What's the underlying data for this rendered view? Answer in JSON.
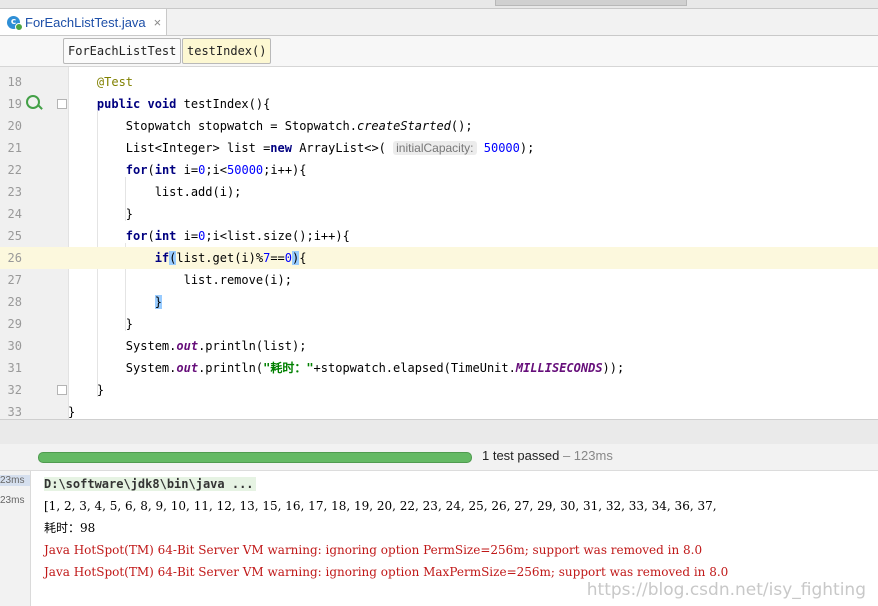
{
  "file_tab": {
    "filename": "ForEachListTest.java",
    "close_glyph": "×",
    "icon": "java-class-icon"
  },
  "breadcrumbs": [
    "ForEachListTest",
    "testIndex()"
  ],
  "editor": {
    "line_numbers": [
      "18",
      "19",
      "20",
      "21",
      "22",
      "23",
      "24",
      "25",
      "26",
      "27",
      "28",
      "29",
      "30",
      "31",
      "32",
      "33"
    ],
    "hint_label": "initialCapacity:",
    "highlighted_line": "26"
  },
  "test_runner": {
    "status": "1 test passed",
    "duration": "– 123ms"
  },
  "console": {
    "timestamps": [
      "23ms",
      "23ms"
    ],
    "command": "D:\\software\\jdk8\\bin\\java ...",
    "output_list": "[1, 2, 3, 4, 5, 6, 8, 9, 10, 11, 12, 13, 15, 16, 17, 18, 19, 20, 22, 23, 24, 25, 26, 27, 29, 30, 31, 32, 33, 34, 36, 37,",
    "elapsed": "耗时：98",
    "warnings": [
      "Java HotSpot(TM) 64-Bit Server VM warning: ignoring option PermSize=256m; support was removed in 8.0",
      "Java HotSpot(TM) 64-Bit Server VM warning: ignoring option MaxPermSize=256m; support was removed in 8.0"
    ]
  },
  "watermark": "https://blog.csdn.net/isy_fighting"
}
